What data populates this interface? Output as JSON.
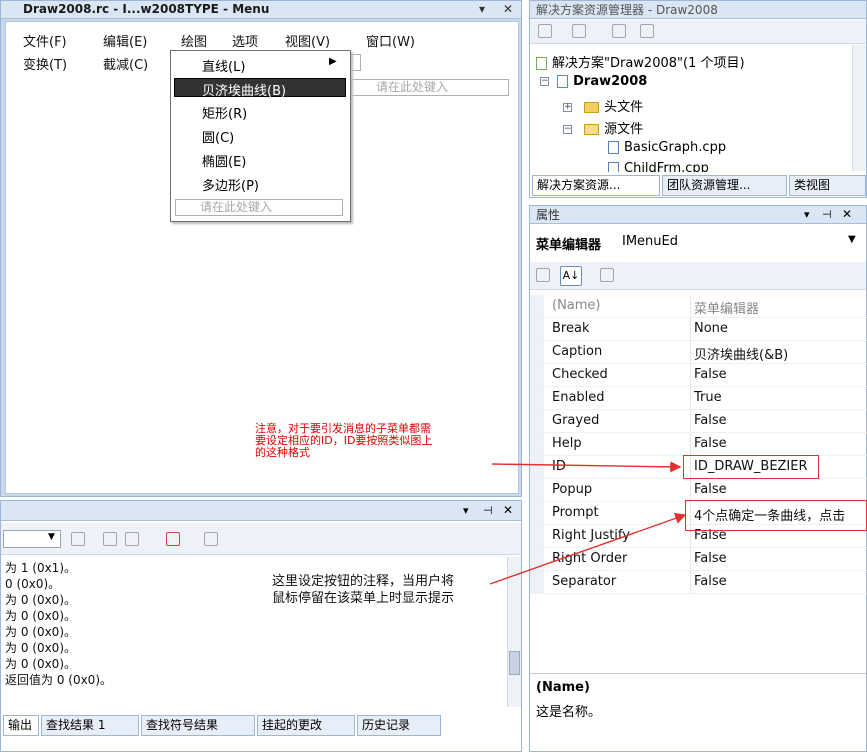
{
  "editor": {
    "title": "Draw2008.rc - I...w2008TYPE - Menu",
    "title_buttons": [
      "▾",
      "⊣",
      "✕"
    ],
    "menubar_row1": [
      "文件(F)",
      "编辑(E)",
      "绘图",
      "选项",
      "视图(V)",
      "窗口(W)"
    ],
    "menubar_row2": [
      "变换(T)",
      "截减(C)"
    ],
    "type_here": "请在此处键入"
  },
  "dropdown": {
    "items": [
      "直线(L)",
      "贝济埃曲线(B)",
      "矩形(R)",
      "圆(C)",
      "椭圆(E)",
      "多边形(P)"
    ],
    "selected_index": 1,
    "submenu_arrow": "▶",
    "type_here": "请在此处键入"
  },
  "solution": {
    "header": "解决方案资源管理器 - Draw2008",
    "root": "解决方案\"Draw2008\"(1 个项目)",
    "project": "Draw2008",
    "folders": [
      "头文件",
      "源文件"
    ],
    "files": [
      "BasicGraph.cpp",
      "ChildFrm.cpp"
    ],
    "tabs": [
      "解决方案资源...",
      "团队资源管理...",
      "类视图"
    ]
  },
  "properties": {
    "header": "属性",
    "selector_label": "菜单编辑器",
    "selector_value": "IMenuEd",
    "rows": [
      {
        "name": "(Name)",
        "value": "菜单编辑器",
        "dim": true
      },
      {
        "name": "Break",
        "value": "None"
      },
      {
        "name": "Caption",
        "value": "贝济埃曲线(&B)"
      },
      {
        "name": "Checked",
        "value": "False"
      },
      {
        "name": "Enabled",
        "value": "True"
      },
      {
        "name": "Grayed",
        "value": "False"
      },
      {
        "name": "Help",
        "value": "False"
      },
      {
        "name": "ID",
        "value": "ID_DRAW_BEZIER"
      },
      {
        "name": "Popup",
        "value": "False"
      },
      {
        "name": "Prompt",
        "value": "4个点确定一条曲线，点击"
      },
      {
        "name": "Right Justify",
        "value": "False"
      },
      {
        "name": "Right Order",
        "value": "False"
      },
      {
        "name": "Separator",
        "value": "False"
      }
    ],
    "desc_title": "(Name)",
    "desc_text": "这是名称。"
  },
  "output": {
    "header_buttons": [
      "▾",
      "⊣",
      "✕"
    ],
    "lines": [
      "为 1 (0x1)。",
      "0 (0x0)。",
      "为 0 (0x0)。",
      "为 0 (0x0)。",
      "为 0 (0x0)。",
      "为 0 (0x0)。",
      "为 0 (0x0)。",
      "返回值为 0 (0x0)。"
    ],
    "tabs": [
      "输出",
      "查找结果 1",
      "查找符号结果",
      "挂起的更改",
      "历史记录"
    ]
  },
  "annotations": {
    "note_red": [
      "注意，对于要引发消息的子菜单都需",
      "要设定相应的ID，ID要按照类似图上",
      "的这种格式"
    ],
    "note_black": [
      "这里设定按钮的注释，当用户将",
      "鼠标停留在该菜单上时显示提示"
    ]
  },
  "colors": {
    "annotation_red": "#e00000",
    "panel_blue": "#c9d9ec",
    "selected_item": "#333333"
  }
}
